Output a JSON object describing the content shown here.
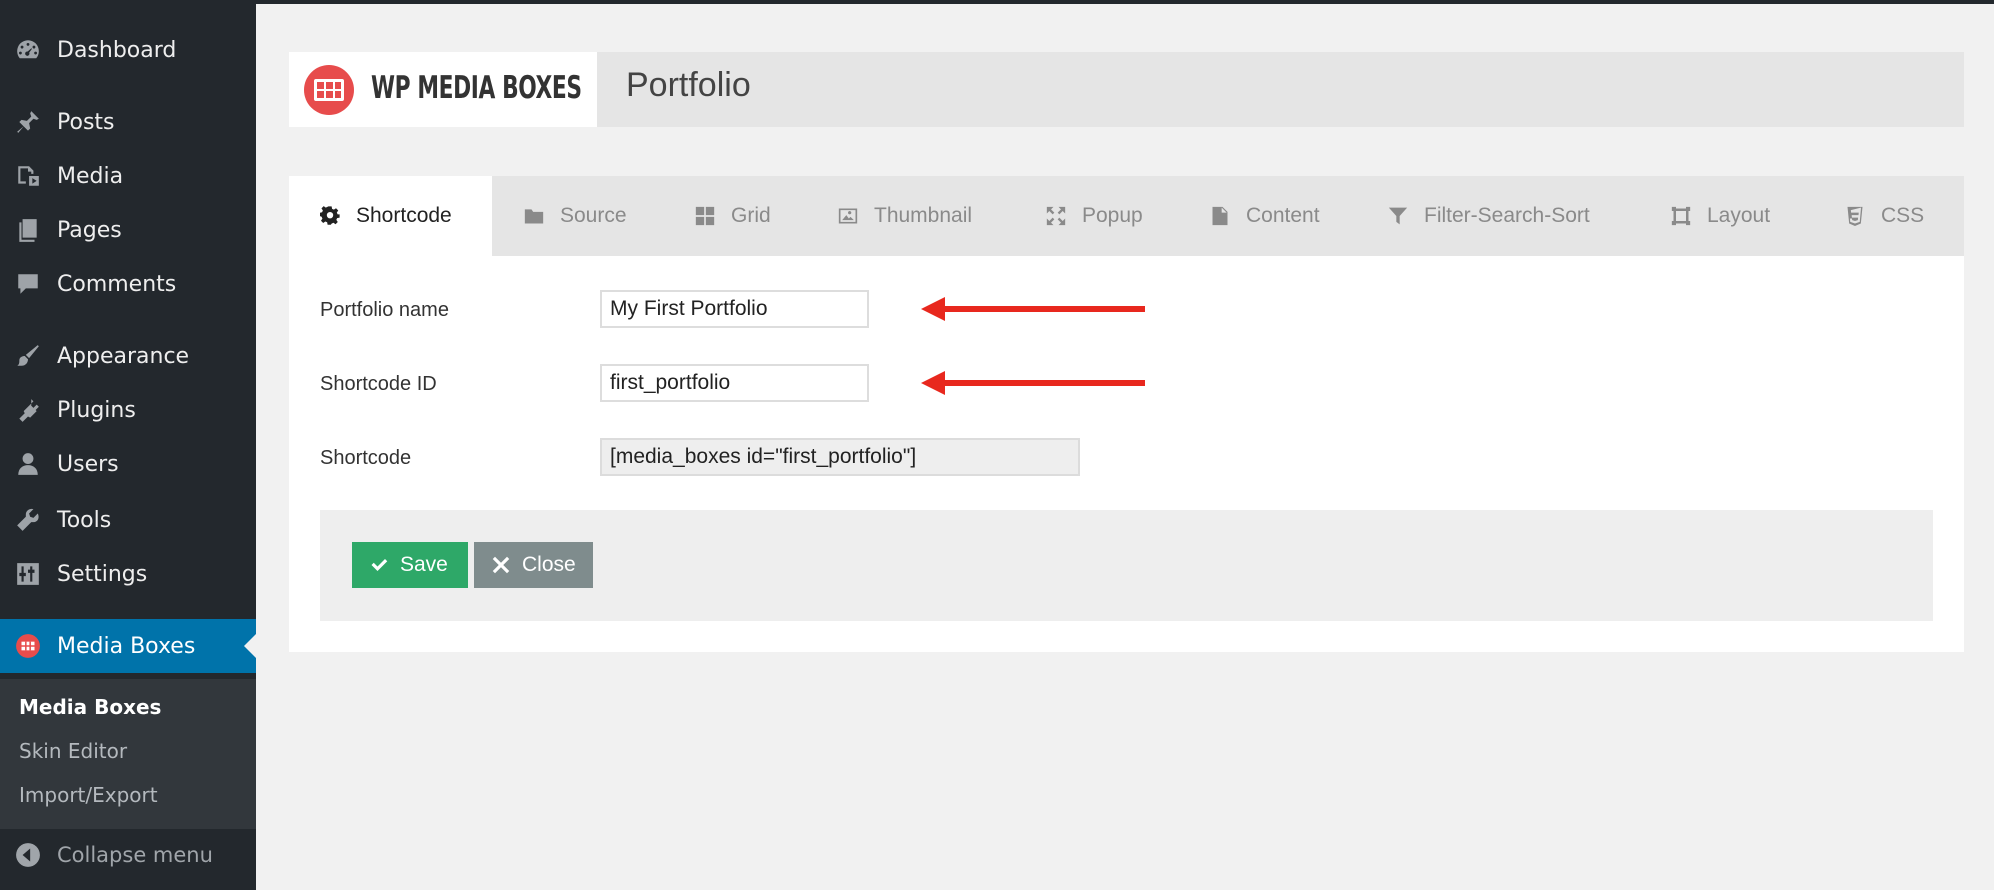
{
  "sidebar": {
    "items": [
      {
        "label": "Dashboard",
        "icon": "dashboard-icon"
      },
      {
        "label": "Posts",
        "icon": "pin-icon"
      },
      {
        "label": "Media",
        "icon": "media-icon"
      },
      {
        "label": "Pages",
        "icon": "pages-icon"
      },
      {
        "label": "Comments",
        "icon": "comment-icon"
      },
      {
        "label": "Appearance",
        "icon": "brush-icon"
      },
      {
        "label": "Plugins",
        "icon": "plug-icon"
      },
      {
        "label": "Users",
        "icon": "user-icon"
      },
      {
        "label": "Tools",
        "icon": "wrench-icon"
      },
      {
        "label": "Settings",
        "icon": "settings-icon"
      }
    ],
    "active": {
      "label": "Media Boxes",
      "icon": "media-boxes-icon"
    },
    "submenu": [
      "Media Boxes",
      "Skin Editor",
      "Import/Export"
    ],
    "collapse": "Collapse menu"
  },
  "header": {
    "brand": "WP MEDIA BOXES",
    "title": "Portfolio"
  },
  "tabs": [
    {
      "label": "Shortcode",
      "icon": "gear-icon"
    },
    {
      "label": "Source",
      "icon": "folder-icon"
    },
    {
      "label": "Grid",
      "icon": "grid-icon"
    },
    {
      "label": "Thumbnail",
      "icon": "image-icon"
    },
    {
      "label": "Popup",
      "icon": "expand-icon"
    },
    {
      "label": "Content",
      "icon": "file-icon"
    },
    {
      "label": "Filter-Search-Sort",
      "icon": "filter-icon"
    },
    {
      "label": "Layout",
      "icon": "layout-icon"
    },
    {
      "label": "CSS",
      "icon": "css-icon"
    }
  ],
  "form": {
    "name_label": "Portfolio name",
    "name_value": "My First Portfolio",
    "id_label": "Shortcode ID",
    "id_value": "first_portfolio",
    "shortcode_label": "Shortcode",
    "shortcode_value": "[media_boxes id=\"first_portfolio\"]"
  },
  "buttons": {
    "save": "Save",
    "close": "Close"
  },
  "colors": {
    "sidebar_bg": "#23282d",
    "active_blue": "#0073aa",
    "save_green": "#2ea868",
    "close_gray": "#7f8c8d",
    "arrow_red": "#e8281e",
    "logo_red": "#e74c4c"
  }
}
